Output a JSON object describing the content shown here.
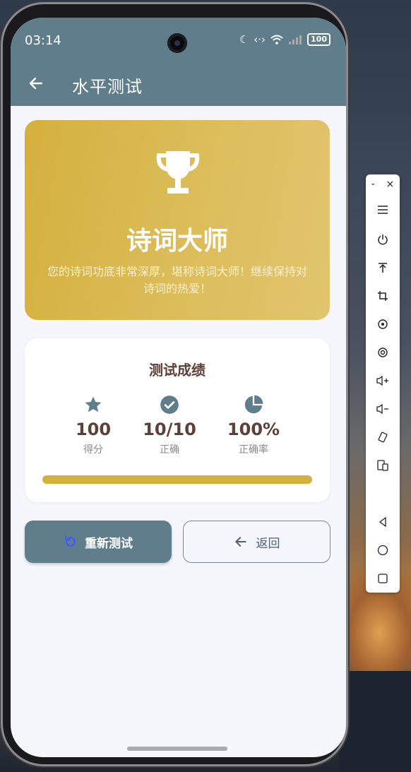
{
  "status_bar": {
    "time": "03:14",
    "battery": "100"
  },
  "app_bar": {
    "title": "水平测试"
  },
  "result": {
    "title": "诗词大师",
    "description": "您的诗词功底非常深厚，堪称诗词大师！继续保持对诗词的热爱！"
  },
  "score_card": {
    "title": "测试成绩",
    "stats": [
      {
        "icon": "star-icon",
        "value": "100",
        "label": "得分"
      },
      {
        "icon": "check-circle-icon",
        "value": "10/10",
        "label": "正确"
      },
      {
        "icon": "pie-chart-icon",
        "value": "100%",
        "label": "正确率"
      }
    ],
    "progress": 1.0
  },
  "buttons": {
    "retry": "重新测试",
    "back": "返回"
  },
  "colors": {
    "primary": "#607d8b",
    "gold": "#d4b03c",
    "brown": "#5d4037"
  },
  "toolbar": {
    "minimize": "-",
    "close": "×"
  }
}
